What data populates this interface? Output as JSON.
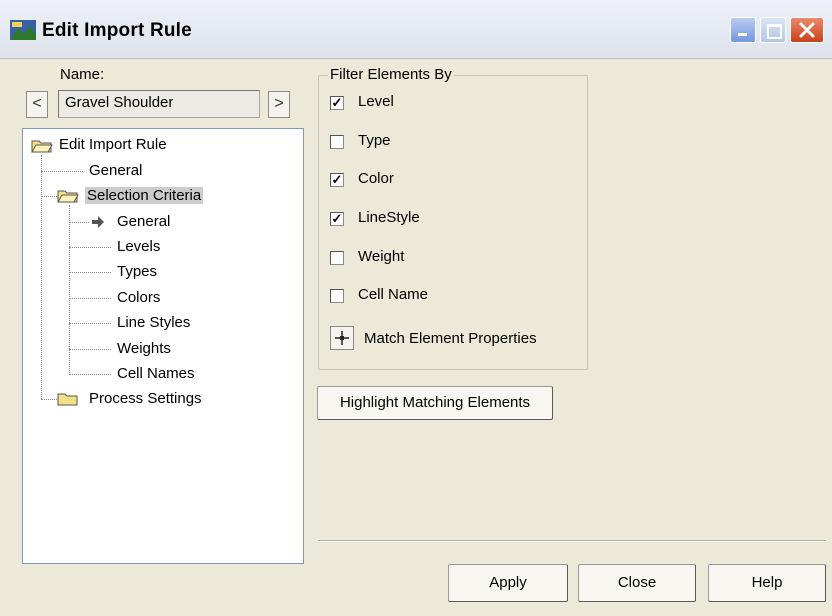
{
  "window": {
    "title": "Edit Import Rule"
  },
  "name_section": {
    "label": "Name:",
    "value": "Gravel Shoulder",
    "prev": "<",
    "next": ">"
  },
  "tree": {
    "root": "Edit Import Rule",
    "items": [
      "General",
      "Selection Criteria",
      "General",
      "Levels",
      "Types",
      "Colors",
      "Line Styles",
      "Weights",
      "Cell Names",
      "Process Settings"
    ]
  },
  "filter": {
    "legend": "Filter Elements By",
    "options": [
      {
        "label": "Level",
        "checked": true
      },
      {
        "label": "Type",
        "checked": false
      },
      {
        "label": "Color",
        "checked": true
      },
      {
        "label": "LineStyle",
        "checked": true
      },
      {
        "label": "Weight",
        "checked": false
      },
      {
        "label": "Cell Name",
        "checked": false
      }
    ],
    "match_label": "Match Element Properties"
  },
  "buttons": {
    "highlight": "Highlight Matching Elements",
    "apply": "Apply",
    "close": "Close",
    "help": "Help"
  },
  "colors": {
    "selection": "#cccccc",
    "dialog_bg": "#ece9d8",
    "close_button": "#d9532f"
  }
}
